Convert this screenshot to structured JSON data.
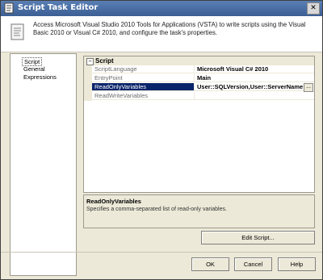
{
  "window": {
    "title": "Script Task Editor"
  },
  "header": {
    "description": "Access Microsoft Visual Studio 2010 Tools for Applications (VSTA) to write scripts using the Visual Basic 2010 or Visual C# 2010, and configure the task's properties."
  },
  "left_nav": {
    "items": [
      {
        "label": "Script"
      },
      {
        "label": "General"
      },
      {
        "label": "Expressions"
      }
    ]
  },
  "grid": {
    "category": "Script",
    "rows": [
      {
        "name": "ScriptLanguage",
        "value": "Microsoft Visual C# 2010"
      },
      {
        "name": "EntryPoint",
        "value": "Main"
      },
      {
        "name": "ReadOnlyVariables",
        "value": "User::SQLVersion,User::ServerName"
      },
      {
        "name": "ReadWriteVariables",
        "value": ""
      }
    ],
    "ellipsis_label": "..."
  },
  "description": {
    "title": "ReadOnlyVariables",
    "text": "Specifies a comma-separated list of read-only variables."
  },
  "buttons": {
    "edit_script": "Edit Script...",
    "ok": "OK",
    "cancel": "Cancel",
    "help": "Help"
  },
  "icons": {
    "close": "close-icon",
    "title": "script-icon",
    "header": "script-document-icon"
  },
  "colors": {
    "titlebar": "#3b5f94",
    "selection": "#0a246a",
    "panel": "#ece9d8"
  }
}
